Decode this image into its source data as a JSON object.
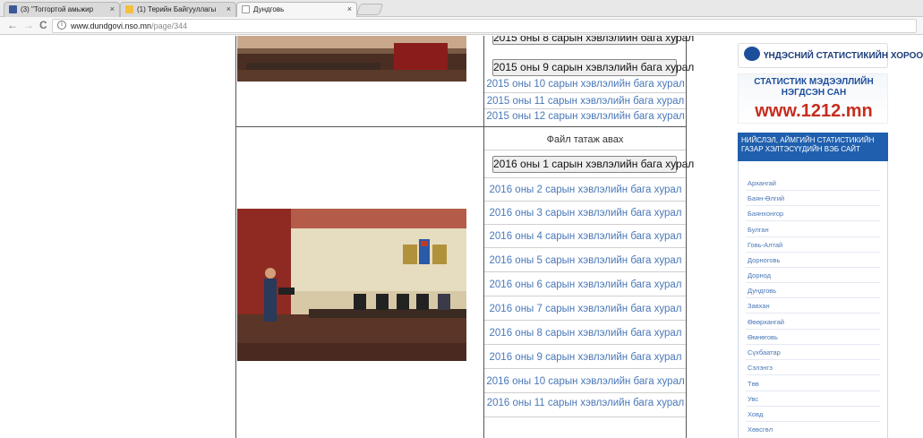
{
  "browser": {
    "tabs": [
      {
        "label": "(3) \"Тоггортой амьжир",
        "close": "×",
        "favicon_color": "#3b5998"
      },
      {
        "label": "(1) Терийн Байгууллагы",
        "close": "×",
        "favicon_color": "#f2c040"
      },
      {
        "label": "Дундговь",
        "close": "×",
        "favicon_color": "#ffffff"
      }
    ],
    "active_tab": 2,
    "url_host": "www.dundgovi.nso.mn",
    "url_path": "/page/344",
    "back": "←",
    "forward": "→",
    "reload": "C",
    "info": "i"
  },
  "table": {
    "section_2015": [
      {
        "label": "2015 оны 8 сарын хэвлэлийн бага хурал",
        "type": "button"
      },
      {
        "label": "2015 оны 9 сарын хэвлэлийн бага хурал",
        "type": "button"
      },
      {
        "label": "2015 оны 10 сарын хэвлэлийн бага хурал",
        "type": "link"
      },
      {
        "label": "2015 оны 11 сарын хэвлэлийн  бага хурал",
        "type": "link"
      },
      {
        "label": "2015 оны 12 сарын хэвлэлийн  бага хурал",
        "type": "link"
      }
    ],
    "file_download_label": "Файл татаж авах",
    "section_2016": [
      {
        "label": "2016 оны 1 сарын хэвлэлийн бага хурал",
        "type": "button"
      },
      {
        "label": "2016 оны 2 сарын хэвлэлийн бага хурал",
        "type": "link"
      },
      {
        "label": "2016 оны 3 сарын хэвлэлийн бага хурал",
        "type": "link"
      },
      {
        "label": "2016 оны 4 сарын хэвлэлийн бага хурал",
        "type": "link"
      },
      {
        "label": "2016 оны 5 сарын хэвлэлийн бага хурал",
        "type": "link"
      },
      {
        "label": "2016 оны 6 сарын хэвлэлийн бага хурал",
        "type": "link"
      },
      {
        "label": "2016 оны 7 сарын хэвлэлийн бага хурал",
        "type": "link"
      },
      {
        "label": "2016 оны 8 сарын хэвлэлийн бага хурал",
        "type": "link"
      },
      {
        "label": "2016 оны 9 сарын хэвлэлийн бага хурал",
        "type": "link"
      },
      {
        "label": "2016 оны 10 сарын хэвлэлийн бага хурал",
        "type": "link"
      },
      {
        "label": "2016 оны 11 сарын хэвлэлийн бага хурал",
        "type": "link"
      }
    ]
  },
  "sidebar": {
    "logo_text": "ҮНДЭСНИЙ СТАТИСТИКИЙН ХОРОО",
    "banner_line1": "СТАТИСТИК МЭДЭЭЛЛИЙН",
    "banner_line2": "НЭГДСЭН САН",
    "banner_url": "www.1212.mn",
    "websites_heading": "НИЙСЛЭЛ, АЙМГИЙН СТАТИСТИКИЙН ГАЗАР ХЭЛТЭСҮҮДИЙН ВЭБ САЙТ",
    "aimags": [
      "Архангай",
      "Баян-Өлгий",
      "Баянхонгор",
      "Булган",
      "Говь-Алтай",
      "Дорноговь",
      "Дорнод",
      "Дундговь",
      "Завхан",
      "Өвөрхангай",
      "Өмнөговь",
      "Сүхбаатар",
      "Сэлэнгэ",
      "Төв",
      "Увс",
      "Ховд",
      "Хөвсгөл"
    ]
  },
  "colors": {
    "link": "#4a78b8",
    "sidebar_header": "#1f5fae",
    "banner_url": "#c62d1f"
  }
}
